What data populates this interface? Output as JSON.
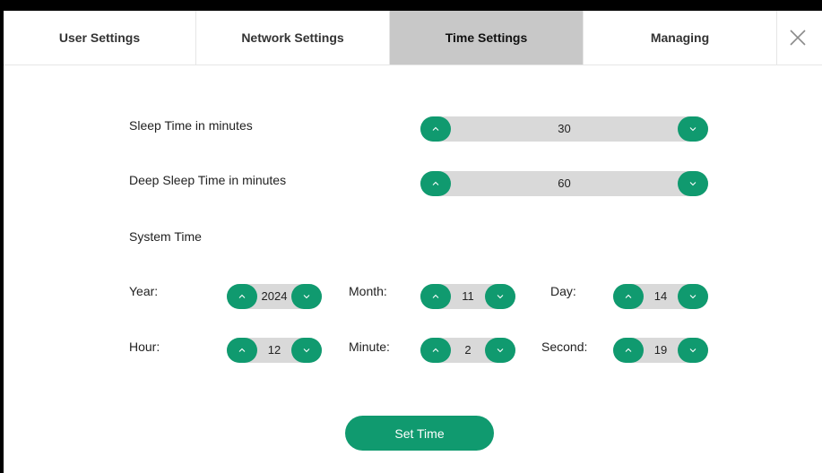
{
  "tabs": {
    "user": "User Settings",
    "network": "Network Settings",
    "time": "Time Settings",
    "managing": "Managing"
  },
  "active_tab": "Time Settings",
  "colors": {
    "accent": "#109a6f",
    "tab_active_bg": "#c8c8c8",
    "spinner_bg": "#d9d9d9"
  },
  "icons": {
    "close": "close-icon",
    "increment": "chevron-up-icon",
    "decrement": "chevron-down-icon"
  },
  "sleep": {
    "label": "Sleep Time in minutes",
    "value": "30"
  },
  "deep_sleep": {
    "label": "Deep Sleep Time in minutes",
    "value": "60"
  },
  "system_time": {
    "heading": "System Time",
    "year": {
      "label": "Year:",
      "value": "2024"
    },
    "month": {
      "label": "Month:",
      "value": "11"
    },
    "day": {
      "label": "Day:",
      "value": "14"
    },
    "hour": {
      "label": "Hour:",
      "value": "12"
    },
    "minute": {
      "label": "Minute:",
      "value": "2"
    },
    "second": {
      "label": "Second:",
      "value": "19"
    }
  },
  "set_time_button": "Set Time"
}
